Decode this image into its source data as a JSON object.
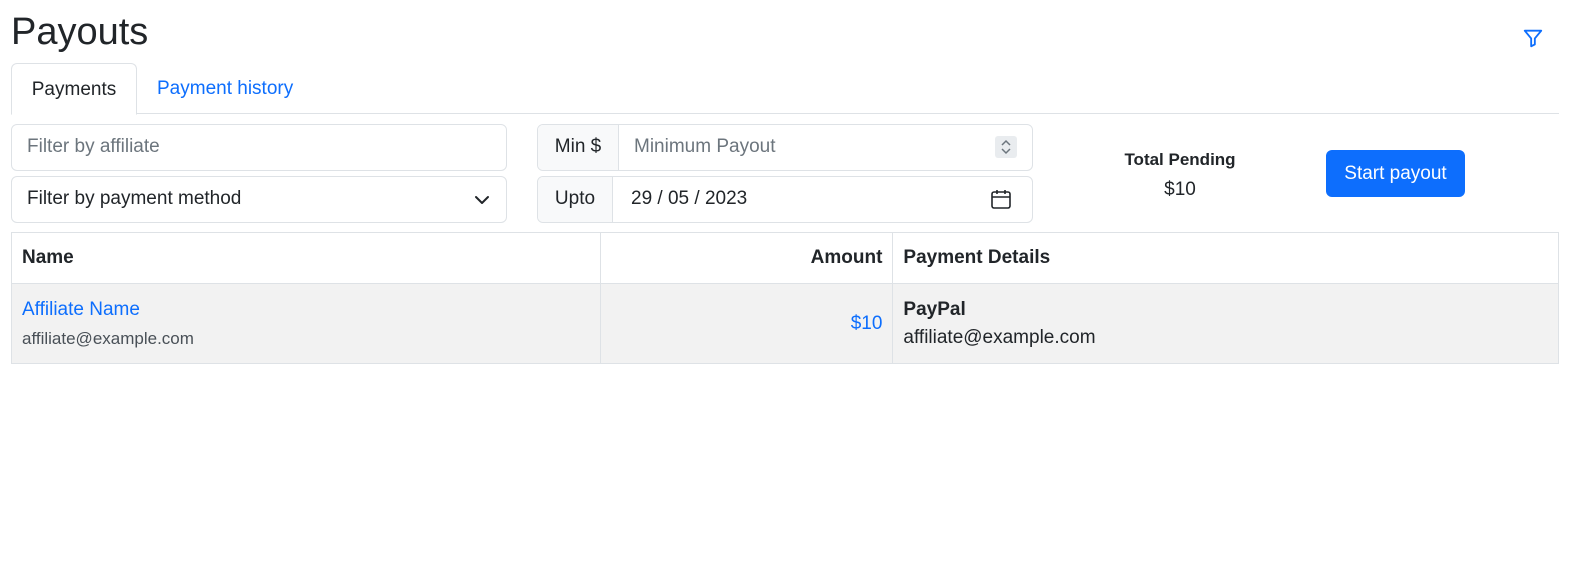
{
  "page": {
    "title": "Payouts",
    "filter_icon": "funnel-icon"
  },
  "tabs": [
    {
      "label": "Payments",
      "active": true
    },
    {
      "label": "Payment history",
      "active": false
    }
  ],
  "filters": {
    "affiliate_placeholder": "Filter by affiliate",
    "payment_method_value": "Filter by payment method",
    "min_addon": "Min $",
    "min_placeholder": "Minimum Payout",
    "upto_addon": "Upto",
    "upto_value": "29 / 05 / 2023"
  },
  "summary": {
    "label": "Total Pending",
    "value": "$10"
  },
  "actions": {
    "start_payout": "Start payout"
  },
  "table": {
    "headers": {
      "name": "Name",
      "amount": "Amount",
      "details": "Payment Details"
    },
    "rows": [
      {
        "name": "Affiliate Name",
        "email": "affiliate@example.com",
        "amount": "$10",
        "method": "PayPal",
        "method_detail": "affiliate@example.com"
      }
    ]
  },
  "colors": {
    "accent": "#0d6efd",
    "border": "#dee2e6",
    "row_bg": "#f2f2f2",
    "addon_bg": "#f8f9fa"
  }
}
